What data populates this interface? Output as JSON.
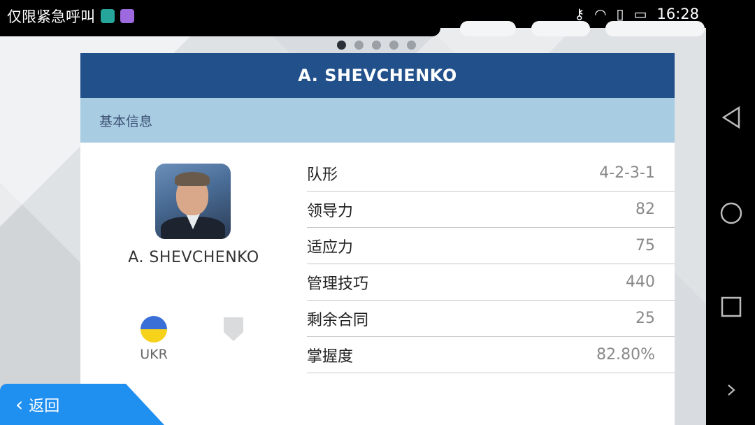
{
  "statusbar": {
    "carrier_text": "仅限紧急呼叫",
    "time": "16:28"
  },
  "pager": {
    "count": 5,
    "active_index": 0
  },
  "card": {
    "title": "A. SHEVCHENKO",
    "section_title": "基本信息"
  },
  "player": {
    "name": "A. SHEVCHENKO",
    "country_code": "UKR"
  },
  "stats": [
    {
      "label": "队形",
      "value": "4-2-3-1"
    },
    {
      "label": "领导力",
      "value": "82"
    },
    {
      "label": "适应力",
      "value": "75"
    },
    {
      "label": "管理技巧",
      "value": "440"
    },
    {
      "label": "剩余合同",
      "value": "25"
    },
    {
      "label": "掌握度",
      "value": "82.80%"
    }
  ],
  "back_button": {
    "label": "返回"
  },
  "colors": {
    "header_blue": "#22508a",
    "section_blue": "#a8cde3",
    "back_button_blue": "#1f8ff0"
  }
}
